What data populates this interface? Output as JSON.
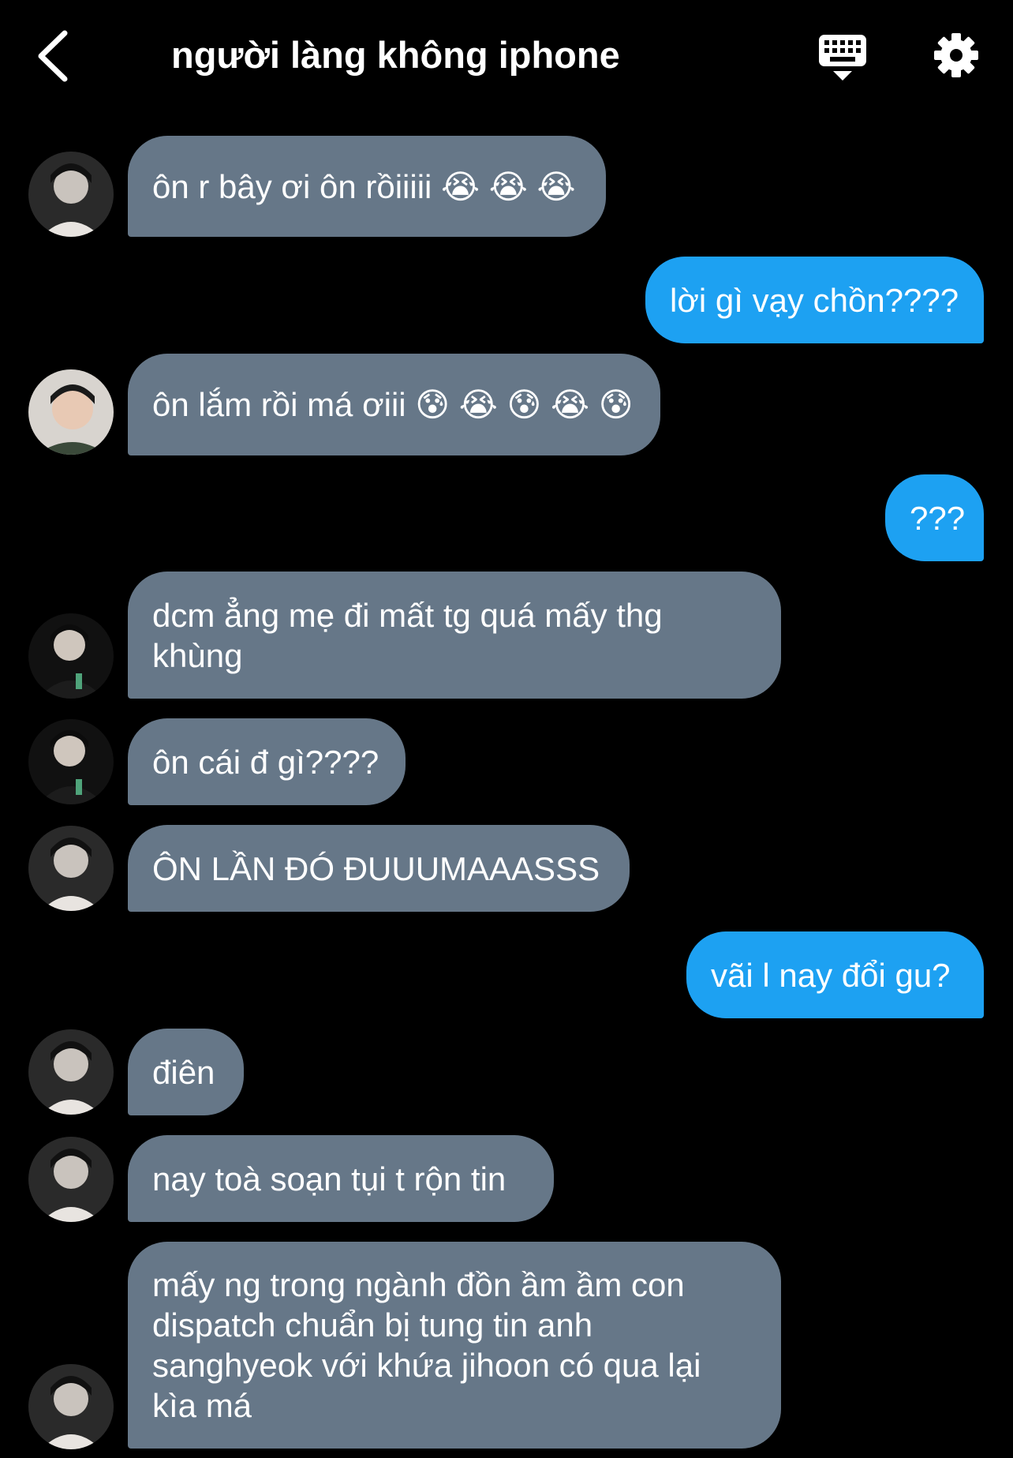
{
  "header": {
    "title": "người làng không iphone",
    "back_icon": "chevron-left-icon",
    "keyboard_icon": "keyboard-icon",
    "settings_icon": "gear-icon"
  },
  "colors": {
    "background": "#000000",
    "incoming_bubble": "#667788",
    "outgoing_bubble": "#1da1f2"
  },
  "messages": [
    {
      "side": "in",
      "text": "ôn r bây ơi ôn rồiiiii 😭 😭 😭"
    },
    {
      "side": "out",
      "text": "lời gì vạy chồn????"
    },
    {
      "side": "in",
      "text": "ôn lắm rồi má ơiii 😰 😭 😰 😭 😰"
    },
    {
      "side": "out",
      "text": "???"
    },
    {
      "side": "in",
      "text": "dcm ẳng mẹ đi mất tg quá mấy thg\nkhùng"
    },
    {
      "side": "in",
      "text": "ôn cái đ gì????"
    },
    {
      "side": "in",
      "text": "ÔN LẦN ĐÓ ĐUUUMAAASSS"
    },
    {
      "side": "out",
      "text": "vãi l nay đổi gu?"
    },
    {
      "side": "in",
      "text": "điên"
    },
    {
      "side": "in",
      "text": "nay toà soạn tụi t rộn tin"
    },
    {
      "side": "in",
      "text": "mấy ng trong ngành đồn ầm ầm con\ndispatch chuẩn bị tung tin anh\nsanghyeok với khứa jihoon có qua lại\nkìa má"
    }
  ]
}
